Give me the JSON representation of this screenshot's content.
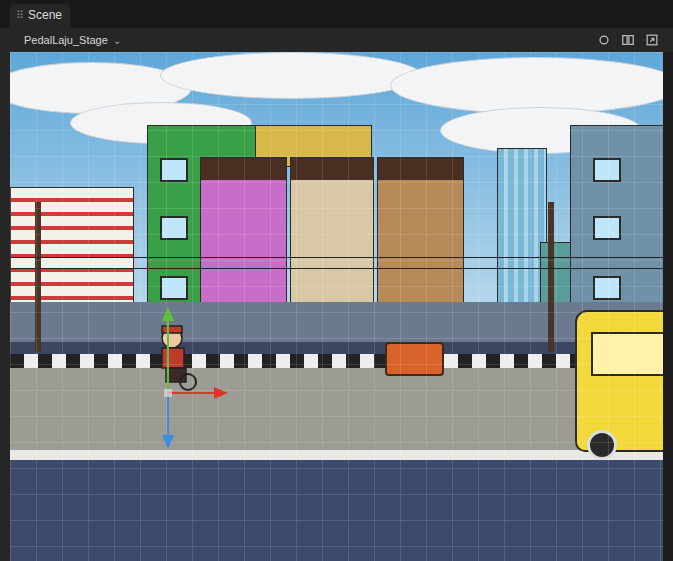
{
  "window": {
    "tab": {
      "icon": "⠿",
      "label": "Scene",
      "selected": true
    }
  },
  "toolbar": {
    "scene_selector": {
      "label": "PedalLaju_Stage",
      "caret": "⌄"
    }
  },
  "viewport": {
    "gizmo": {
      "selected": true
    }
  }
}
